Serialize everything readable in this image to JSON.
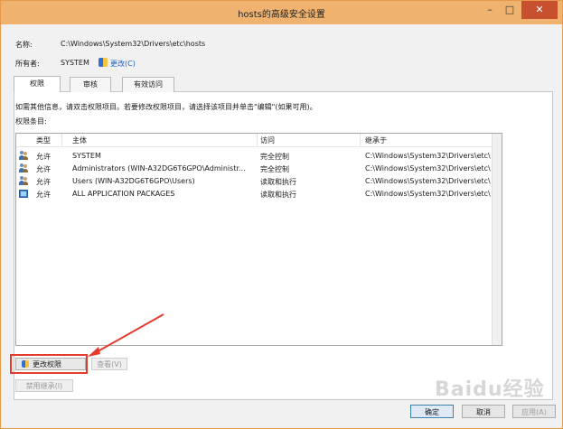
{
  "window": {
    "title": "hosts的高级安全设置",
    "min_glyph": "–",
    "max_glyph": "□",
    "close_glyph": "✕"
  },
  "fields": {
    "name_label": "名称:",
    "name_value": "C:\\Windows\\System32\\Drivers\\etc\\hosts",
    "owner_label": "所有者:",
    "owner_value": "SYSTEM",
    "change_owner_link": "更改(C)"
  },
  "tabs": [
    {
      "label": "权限",
      "active": true
    },
    {
      "label": "审核",
      "active": false
    },
    {
      "label": "有效访问",
      "active": false
    }
  ],
  "info_text": "如需其他信息，请双击权限项目。若要修改权限项目，请选择该项目并单击\"编辑\"(如果可用)。",
  "entries_label": "权限条目:",
  "table": {
    "columns": [
      "类型",
      "主体",
      "访问",
      "继承于"
    ],
    "rows": [
      {
        "icon": "users-icon",
        "type": "允许",
        "principal": "SYSTEM",
        "access": "完全控制",
        "inherited": "C:\\Windows\\System32\\Drivers\\etc\\"
      },
      {
        "icon": "users-icon",
        "type": "允许",
        "principal": "Administrators (WIN-A32DG6T6GPO\\Administr...",
        "access": "完全控制",
        "inherited": "C:\\Windows\\System32\\Drivers\\etc\\"
      },
      {
        "icon": "users-icon",
        "type": "允许",
        "principal": "Users (WIN-A32DG6T6GPO\\Users)",
        "access": "读取和执行",
        "inherited": "C:\\Windows\\System32\\Drivers\\etc\\"
      },
      {
        "icon": "package-icon",
        "type": "允许",
        "principal": "ALL APPLICATION PACKAGES",
        "access": "读取和执行",
        "inherited": "C:\\Windows\\System32\\Drivers\\etc\\"
      }
    ]
  },
  "buttons": {
    "change_permissions": "更改权限",
    "view": "查看(V)",
    "disable_inheritance": "禁用继承(I)",
    "ok": "确定",
    "cancel": "取消",
    "apply": "应用(A)"
  },
  "watermark": "Baidu经验",
  "colors": {
    "titlebar": "#f0b36f",
    "highlight": "#e43b2c",
    "link": "#1f5fbf"
  }
}
